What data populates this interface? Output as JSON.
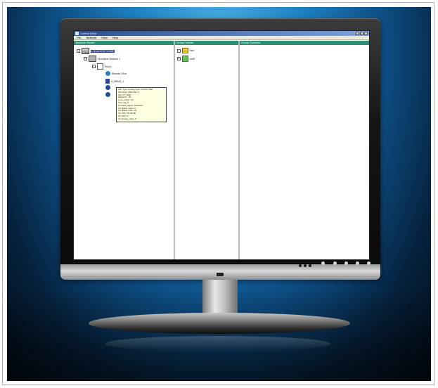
{
  "window": {
    "title": "Control Deck",
    "menu": [
      "File",
      "Network",
      "View",
      "Help"
    ]
  },
  "panes": {
    "network_viewer": "Network Viewer",
    "group_viewer": "Group Viewer",
    "group_controls": "Group Controls"
  },
  "network_tree": [
    {
      "label": "LOCALHOST:12345",
      "selected": true
    },
    {
      "label": "Modulbus Network 1"
    },
    {
      "label": "Rack1"
    },
    {
      "label": "Remote1 Bus"
    },
    {
      "label": "A_MBUS_1"
    }
  ],
  "tooltip_lines": [
    "LEF Type: Analog Input (ST100 TSE)",
    "Firmware: 2002 Rev. 0",
    "Tag: PT_0001",
    "Serial No.: 30",
    "Loop_power: No",
    "Time tag: 0",
    "I/O Fault_status: Reduced",
    "I/O digital_value: 0",
    "I/O digital_units: psi",
    "I/O URV: 50.00700",
    "I/O LRV: 0",
    "I/O analog_value: 0"
  ],
  "group_tree": [
    {
      "label": "ssm"
    },
    {
      "label": "stuff"
    }
  ]
}
